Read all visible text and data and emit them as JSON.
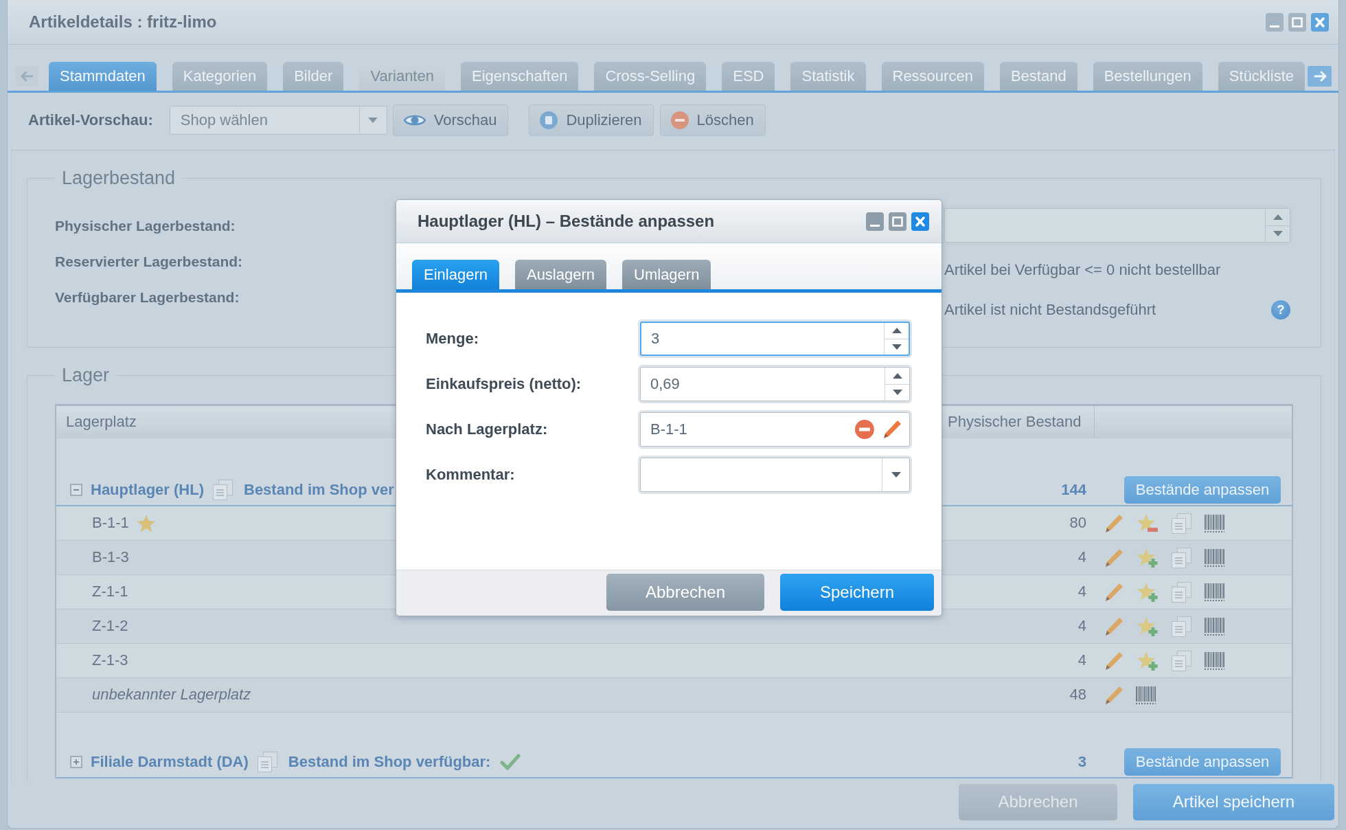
{
  "window": {
    "title": "Artikeldetails : fritz-limo"
  },
  "tabs": [
    {
      "label": "Stammdaten",
      "selected": true,
      "disabled": false
    },
    {
      "label": "Kategorien",
      "selected": false,
      "disabled": false
    },
    {
      "label": "Bilder",
      "selected": false,
      "disabled": false
    },
    {
      "label": "Varianten",
      "selected": false,
      "disabled": true
    },
    {
      "label": "Eigenschaften",
      "selected": false,
      "disabled": false
    },
    {
      "label": "Cross-Selling",
      "selected": false,
      "disabled": false
    },
    {
      "label": "ESD",
      "selected": false,
      "disabled": false
    },
    {
      "label": "Statistik",
      "selected": false,
      "disabled": false
    },
    {
      "label": "Ressourcen",
      "selected": false,
      "disabled": false
    },
    {
      "label": "Bestand",
      "selected": false,
      "disabled": false
    },
    {
      "label": "Bestellungen",
      "selected": false,
      "disabled": false
    },
    {
      "label": "Stückliste",
      "selected": false,
      "disabled": false
    }
  ],
  "toolbar": {
    "label": "Artikel-Vorschau:",
    "shop_select": {
      "placeholder": "Shop wählen"
    },
    "buttons": [
      {
        "kind": "preview",
        "label": "Vorschau"
      },
      {
        "kind": "duplicate",
        "label": "Duplizieren"
      },
      {
        "kind": "delete",
        "label": "Löschen"
      }
    ]
  },
  "stock": {
    "legend": "Lagerbestand",
    "labels": [
      "Physischer Lagerbestand:",
      "Reservierter Lagerbestand:",
      "Verfügbarer Lagerbestand:"
    ],
    "options": [
      "Artikel bei Verfügbar <= 0 nicht bestellbar",
      "Artikel ist nicht Bestandsgeführt"
    ],
    "help": "?"
  },
  "warehouses": {
    "legend": "Lager",
    "columns": [
      "Lagerplatz",
      "Physischer Bestand"
    ],
    "groups": [
      {
        "name": "Hauptlager (HL)",
        "expanded": true,
        "shop_label": "Bestand im Shop ver",
        "total": "144",
        "button": "Bestände anpassen",
        "rows": [
          {
            "kind": "location",
            "place": "B-1-1",
            "default": true,
            "stock": "80"
          },
          {
            "kind": "location",
            "place": "B-1-3",
            "default": false,
            "stock": "4"
          },
          {
            "kind": "location",
            "place": "Z-1-1",
            "default": false,
            "stock": "4"
          },
          {
            "kind": "location",
            "place": "Z-1-2",
            "default": false,
            "stock": "4"
          },
          {
            "kind": "location",
            "place": "Z-1-3",
            "default": false,
            "stock": "4"
          },
          {
            "kind": "unknown",
            "place": "unbekannter Lagerplatz",
            "stock": "48"
          }
        ]
      },
      {
        "name": "Filiale Darmstadt (DA)",
        "expanded": false,
        "shop_label": "Bestand im Shop verfügbar:",
        "shop_available": true,
        "total": "3",
        "button": "Bestände anpassen"
      }
    ]
  },
  "footer": {
    "buttons": [
      {
        "kind": "secondary",
        "label": "Abbrechen"
      },
      {
        "kind": "primary",
        "label": "Artikel speichern"
      }
    ]
  },
  "dialog": {
    "title": "Hauptlager (HL) – Bestände anpassen",
    "tabs": [
      {
        "label": "Einlagern",
        "selected": true
      },
      {
        "label": "Auslagern",
        "selected": false
      },
      {
        "label": "Umlagern",
        "selected": false
      }
    ],
    "fields": [
      {
        "kind": "number",
        "label": "Menge:",
        "value": "3",
        "focused": true
      },
      {
        "kind": "number",
        "label": "Einkaufspreis (netto):",
        "value": "0,69",
        "focused": false
      },
      {
        "kind": "location",
        "label": "Nach Lagerplatz:",
        "value": "B-1-1",
        "focused": false
      },
      {
        "kind": "combo",
        "label": "Kommentar:",
        "focused": false
      }
    ],
    "buttons": [
      {
        "kind": "secondary",
        "label": "Abbrechen"
      },
      {
        "kind": "primary",
        "label": "Speichern"
      }
    ]
  }
}
